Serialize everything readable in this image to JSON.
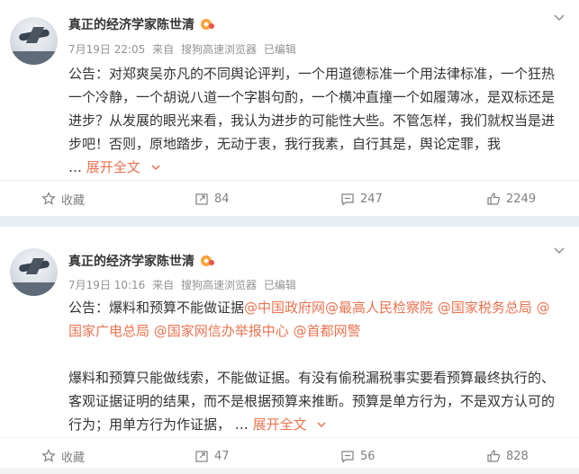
{
  "posts": [
    {
      "author": "真正的经济学家陈世清",
      "time": "7月19日 22:05",
      "source_prefix": "来自",
      "source": "搜狗高速浏览器",
      "edited": "已编辑",
      "text_plain": "公告：对郑爽吴亦凡的不同舆论评判，一个用道德标准一个用法律标准，一个狂热一个冷静，一个胡说八道一个字斟句酌，一个横冲直撞一个如履薄冰，是双标还是进步？从发展的眼光来看，我认为进步的可能性大些。不管怎样，我们就权当是进步吧！否则，原地踏步，无动于衷，我行我素，自行其是，舆论定罪，我",
      "ellipsis": "…",
      "more_label": "展开全文",
      "actions": {
        "favorite": "收藏",
        "repost": "84",
        "comment": "247",
        "like": "2249"
      }
    },
    {
      "author": "真正的经济学家陈世清",
      "time": "7月19日 10:16",
      "source_prefix": "来自",
      "source": "搜狗高速浏览器",
      "edited": "已编辑",
      "text_intro": "公告：爆料和预算不能做证据",
      "mentions": [
        "@中国政府网",
        "@最高人民检察院",
        "@国家税务总局",
        "@国家广电总局",
        "@国家网信办举报中心",
        "@首都网警"
      ],
      "text_body": "爆料和预算只能做线索，不能做证据。有没有偷税漏税事实要看预算最终执行的、客观证据证明的结果，而不是根据预算来推断。预算是单方行为，不是双方认可的行为；用单方行为作证据，",
      "ellipsis": "…",
      "more_label": "展开全文",
      "actions": {
        "favorite": "收藏",
        "repost": "47",
        "comment": "56",
        "like": "828"
      }
    }
  ],
  "colors": {
    "accent": "#eb7350",
    "meta": "#939393",
    "separator": "#e8eef2"
  }
}
